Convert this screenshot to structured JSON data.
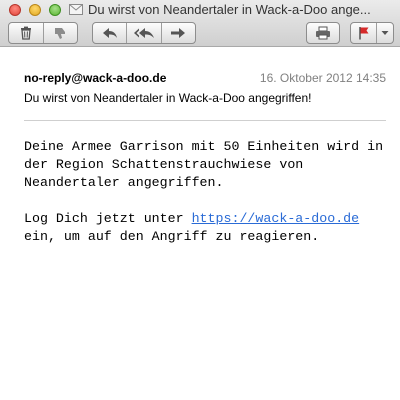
{
  "window": {
    "title": "Du wirst von Neandertaler in Wack-a-Doo ange...",
    "icons": [
      "close-icon",
      "minimize-icon",
      "zoom-icon",
      "envelope-icon"
    ]
  },
  "toolbar": {
    "groups": [
      [
        "trash-icon",
        "junk-thumbs-down-icon"
      ],
      [
        "reply-icon",
        "reply-all-icon",
        "forward-icon"
      ],
      [
        "print-icon"
      ],
      [
        "flag-icon",
        "chevron-down-icon"
      ]
    ],
    "colors": {
      "flag": "#d62a2a"
    }
  },
  "message": {
    "from": "no-reply@wack-a-doo.de",
    "date": "16. Oktober 2012 14:35",
    "subject": "Du wirst von Neandertaler in Wack-a-Doo angegriffen!",
    "paragraph1": "Deine Armee Garrison mit 50 Einheiten wird in der Region Schattenstrauchwiese von Neandertaler angegriffen.",
    "paragraph2_before": "Log Dich jetzt unter ",
    "link": "https://wack-a-doo.de",
    "paragraph2_after": " ein, um auf den Angriff zu reagieren.",
    "colors": {
      "link": "#2a6bd6"
    }
  }
}
